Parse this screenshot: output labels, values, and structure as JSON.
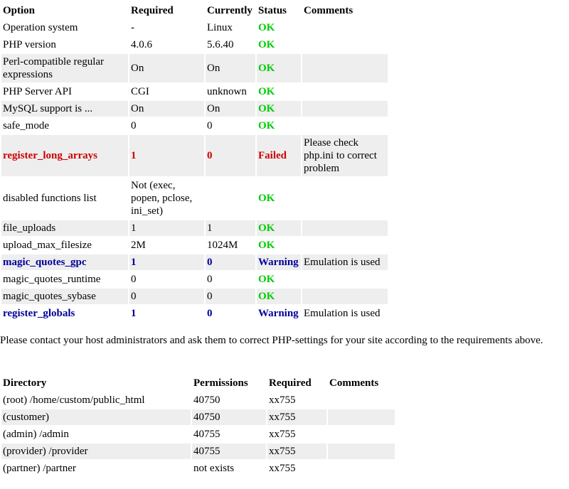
{
  "checks": {
    "headers": [
      "Option",
      "Required",
      "Currently",
      "Status",
      "Comments"
    ],
    "rows": [
      {
        "option": "Operation system",
        "required": "-",
        "current": "Linux",
        "status": "OK",
        "comment": "",
        "state": "ok",
        "shade": false
      },
      {
        "option": "PHP version",
        "required": "4.0.6",
        "current": "5.6.40",
        "status": "OK",
        "comment": "",
        "state": "ok",
        "shade": false
      },
      {
        "option": "Perl-compatible regular expressions",
        "required": "On",
        "current": "On",
        "status": "OK",
        "comment": "",
        "state": "ok",
        "shade": true
      },
      {
        "option": "PHP Server API",
        "required": "CGI",
        "current": "unknown",
        "status": "OK",
        "comment": "",
        "state": "ok",
        "shade": false
      },
      {
        "option": "MySQL support is ...",
        "required": "On",
        "current": "On",
        "status": "OK",
        "comment": "",
        "state": "ok",
        "shade": true
      },
      {
        "option": "safe_mode",
        "required": "0",
        "current": "0",
        "status": "OK",
        "comment": "",
        "state": "ok",
        "shade": false
      },
      {
        "option": "register_long_arrays",
        "required": "1",
        "current": "0",
        "status": "Failed",
        "comment": "Please check php.ini to correct problem",
        "state": "failed",
        "shade": true
      },
      {
        "option": "disabled functions list",
        "required": "Not (exec, popen, pclose, ini_set)",
        "current": "",
        "status": "OK",
        "comment": "",
        "state": "ok",
        "shade": false
      },
      {
        "option": "file_uploads",
        "required": "1",
        "current": "1",
        "status": "OK",
        "comment": "",
        "state": "ok",
        "shade": true
      },
      {
        "option": "upload_max_filesize",
        "required": "2M",
        "current": "1024M",
        "status": "OK",
        "comment": "",
        "state": "ok",
        "shade": false
      },
      {
        "option": "magic_quotes_gpc",
        "required": "1",
        "current": "0",
        "status": "Warning",
        "comment": "Emulation is used",
        "state": "warning",
        "shade": true
      },
      {
        "option": "magic_quotes_runtime",
        "required": "0",
        "current": "0",
        "status": "OK",
        "comment": "",
        "state": "ok",
        "shade": false
      },
      {
        "option": "magic_quotes_sybase",
        "required": "0",
        "current": "0",
        "status": "OK",
        "comment": "",
        "state": "ok",
        "shade": true
      },
      {
        "option": "register_globals",
        "required": "1",
        "current": "0",
        "status": "Warning",
        "comment": "Emulation is used",
        "state": "warning",
        "shade": false
      }
    ]
  },
  "notice": "Please contact your host administrators and ask them to correct PHP-settings for your site according to the requirements above.",
  "dirs": {
    "headers": [
      "Directory",
      "Permissions",
      "Required",
      "Comments"
    ],
    "rows": [
      {
        "dir": "(root) /home/custom/public_html",
        "perm": "40750",
        "required": "xx755",
        "comment": "",
        "shade": false
      },
      {
        "dir": "(customer)",
        "perm": "40750",
        "required": "xx755",
        "comment": "",
        "shade": true
      },
      {
        "dir": "(admin) /admin",
        "perm": "40755",
        "required": "xx755",
        "comment": "",
        "shade": false
      },
      {
        "dir": "(provider) /provider",
        "perm": "40755",
        "required": "xx755",
        "comment": "",
        "shade": true
      },
      {
        "dir": "(partner) /partner",
        "perm": "not exists",
        "required": "xx755",
        "comment": "",
        "shade": false
      }
    ]
  },
  "colors": {
    "ok": "#00cc00",
    "failed": "#cc0000",
    "warning": "#000099",
    "shade": "#eeeeee"
  }
}
